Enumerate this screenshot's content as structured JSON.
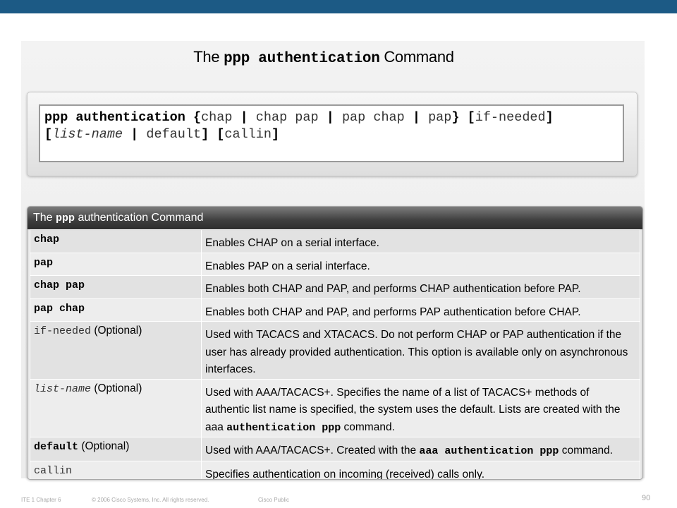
{
  "title": {
    "pre": "The ",
    "mono": "ppp authentication",
    "post": " Command"
  },
  "syntax": {
    "cmd": "ppp authentication",
    "l1_open": " {",
    "o_chap": "chap",
    "o_chap_pap": "chap pap",
    "o_pap_chap": "pap chap",
    "o_pap": "pap",
    "pipe": " | ",
    "l1_close": "}",
    "ifneeded_open": " [",
    "ifneeded": "if-needed",
    "ifneeded_close": "]",
    "l2_open": "[",
    "list_name": "list-name",
    "default_": "default",
    "l2_mid": "] [",
    "callin": "callin",
    "l2_close": "]"
  },
  "table": {
    "header": {
      "pre": "The ",
      "mono": "ppp",
      "post": " authentication Command"
    },
    "rows": [
      {
        "param": "chap",
        "desc": "Enables CHAP on a serial interface."
      },
      {
        "param": "pap",
        "desc": "Enables PAP on a serial interface."
      },
      {
        "param": "chap pap",
        "desc": "Enables both CHAP and PAP, and performs CHAP authentication before PAP."
      },
      {
        "param": "pap chap",
        "desc": "Enables both CHAP and PAP, and performs PAP authentication before CHAP."
      },
      {
        "param": "if-needed",
        "suffix": " (Optional)",
        "desc": "Used with TACACS and XTACACS. Do not perform CHAP or PAP authentication if the user has already provided authentication. This option is available only on asynchronous interfaces."
      },
      {
        "param": "list-name",
        "suffix": " (Optional)",
        "desc_pre": "Used with AAA/TACACS+. Specifies the name of a list of TACACS+ methods of authentic list name is specified, the system uses the default. Lists are created with the aaa ",
        "desc_mono": "authentication ppp",
        "desc_post": " command."
      },
      {
        "param": "default",
        "suffix": " (Optional)",
        "desc_pre": "Used with AAA/TACACS+. Created with the ",
        "desc_mono": "aaa authentication ppp",
        "desc_post": " command."
      },
      {
        "param": "callin",
        "desc": "Specifies authentication on incoming (received) calls only."
      }
    ]
  },
  "footer": {
    "course": "ITE 1 Chapter 6",
    "copyright": "© 2006 Cisco Systems, Inc. All rights reserved.",
    "classification": "Cisco Public",
    "page": "90"
  }
}
